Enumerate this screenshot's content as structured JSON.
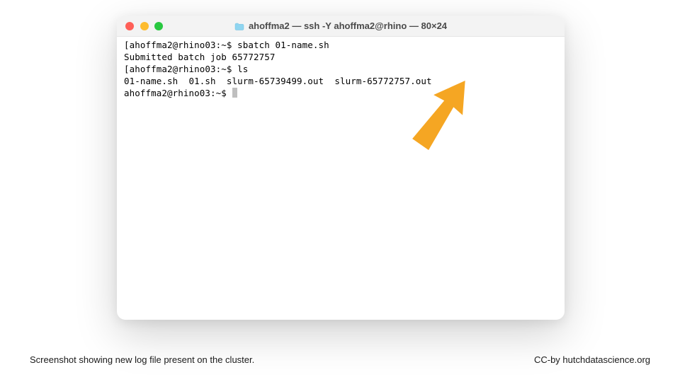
{
  "window": {
    "title": "ahoffma2 — ssh -Y ahoffma2@rhino — 80×24"
  },
  "terminal": {
    "lines": [
      "[ahoffma2@rhino03:~$ sbatch 01-name.sh",
      "Submitted batch job 65772757",
      "[ahoffma2@rhino03:~$ ls",
      "01-name.sh  01.sh  slurm-65739499.out  slurm-65772757.out",
      "ahoffma2@rhino03:~$ "
    ]
  },
  "captions": {
    "left": "Screenshot showing new log file present on the cluster.",
    "right": "CC-by hutchdatascience.org"
  },
  "colors": {
    "arrow": "#f5a623"
  }
}
